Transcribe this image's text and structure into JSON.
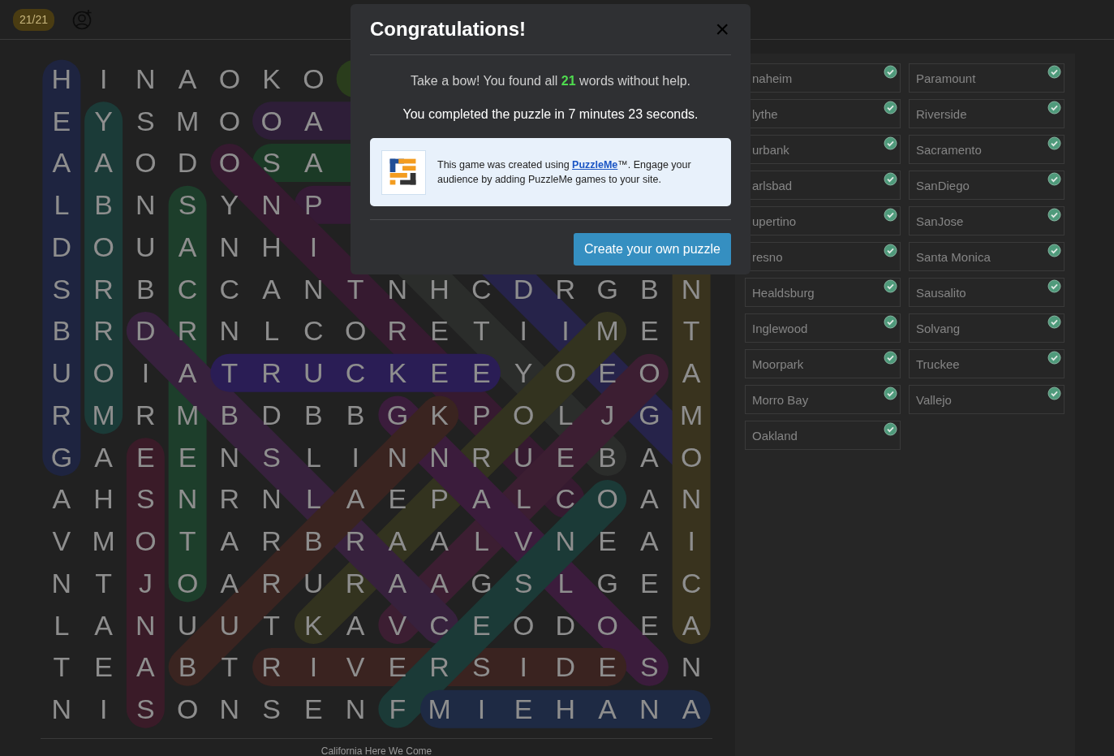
{
  "header": {
    "score": "21/21"
  },
  "grid": {
    "rows": [
      [
        "H",
        "I",
        "N",
        "A",
        "O",
        "K",
        "O"
      ],
      [
        "E",
        "Y",
        "S",
        "M",
        "O",
        "O",
        "A"
      ],
      [
        "A",
        "A",
        "O",
        "D",
        "O",
        "S",
        "A"
      ],
      [
        "L",
        "B",
        "N",
        "S",
        "Y",
        "N",
        "P"
      ],
      [
        "D",
        "O",
        "U",
        "A",
        "N",
        "H",
        "I"
      ],
      [
        "S",
        "R",
        "B",
        "C",
        "C",
        "A",
        "N",
        "T",
        "N",
        "H",
        "C",
        "D",
        "R",
        "G",
        "B",
        "N"
      ],
      [
        "B",
        "R",
        "D",
        "R",
        "N",
        "L",
        "C",
        "O",
        "R",
        "E",
        "T",
        "I",
        "I",
        "M",
        "E",
        "T"
      ],
      [
        "U",
        "O",
        "I",
        "A",
        "T",
        "R",
        "U",
        "C",
        "K",
        "E",
        "E",
        "Y",
        "O",
        "E",
        "O",
        "A"
      ],
      [
        "R",
        "M",
        "R",
        "M",
        "B",
        "D",
        "B",
        "B",
        "G",
        "K",
        "P",
        "O",
        "L",
        "J",
        "G",
        "M"
      ],
      [
        "G",
        "A",
        "E",
        "E",
        "N",
        "S",
        "L",
        "I",
        "N",
        "N",
        "R",
        "U",
        "E",
        "B",
        "A",
        "O"
      ],
      [
        "A",
        "H",
        "S",
        "N",
        "R",
        "N",
        "L",
        "A",
        "E",
        "P",
        "A",
        "L",
        "C",
        "O",
        "A",
        "N"
      ],
      [
        "V",
        "M",
        "O",
        "T",
        "A",
        "R",
        "B",
        "R",
        "A",
        "A",
        "L",
        "V",
        "N",
        "E",
        "A",
        "I"
      ],
      [
        "N",
        "T",
        "J",
        "O",
        "A",
        "R",
        "U",
        "R",
        "A",
        "A",
        "G",
        "S",
        "L",
        "G",
        "E",
        "C"
      ],
      [
        "L",
        "A",
        "N",
        "U",
        "U",
        "T",
        "K",
        "A",
        "V",
        "C",
        "E",
        "O",
        "D",
        "O",
        "E",
        "A"
      ],
      [
        "T",
        "E",
        "A",
        "B",
        "T",
        "R",
        "I",
        "V",
        "E",
        "R",
        "S",
        "I",
        "D",
        "E",
        "S",
        "N"
      ],
      [
        "N",
        "I",
        "S",
        "O",
        "N",
        "S",
        "E",
        "N",
        "F",
        "M",
        "I",
        "E",
        "H",
        "A",
        "N",
        "A"
      ]
    ],
    "caption": "California Here We Come"
  },
  "words": [
    {
      "label": "naheim",
      "found": true
    },
    {
      "label": "lythe",
      "found": true
    },
    {
      "label": "urbank",
      "found": true
    },
    {
      "label": "arlsbad",
      "found": true
    },
    {
      "label": "upertino",
      "found": true
    },
    {
      "label": "resno",
      "found": true
    },
    {
      "label": "Healdsburg",
      "found": true
    },
    {
      "label": "Inglewood",
      "found": true
    },
    {
      "label": "Moorpark",
      "found": true
    },
    {
      "label": "Morro Bay",
      "found": true
    },
    {
      "label": "Oakland",
      "found": true
    },
    {
      "label": "Paramount",
      "found": true
    },
    {
      "label": "Riverside",
      "found": true
    },
    {
      "label": "Sacramento",
      "found": true
    },
    {
      "label": "SanDiego",
      "found": true
    },
    {
      "label": "SanJose",
      "found": true
    },
    {
      "label": "Santa Monica",
      "found": true
    },
    {
      "label": "Sausalito",
      "found": true
    },
    {
      "label": "Solvang",
      "found": true
    },
    {
      "label": "Truckee",
      "found": true
    },
    {
      "label": "Vallejo",
      "found": true
    }
  ],
  "dialog": {
    "title": "Congratulations!",
    "close": "×",
    "message": "Take a bow! You found all **21** words without help.",
    "time": "You completed the puzzle in 7 minutes 23 seconds.",
    "promo": {
      "before": "This game was created using ",
      "link": "PuzzleMe",
      "after": "™. Engage your audience by adding PuzzleMe games to your site."
    },
    "button": "Create your own puzzle"
  }
}
